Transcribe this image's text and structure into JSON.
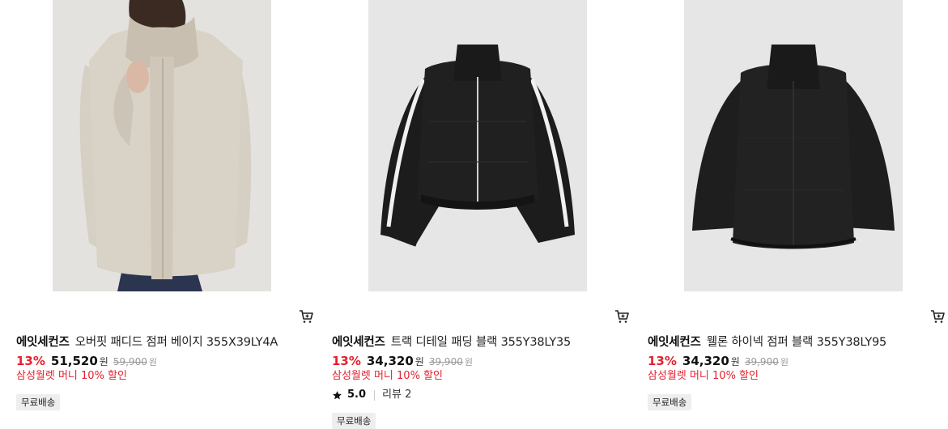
{
  "products": [
    {
      "brand": "에잇세컨즈",
      "name": "오버핏 패디드 점퍼 베이지 355X39LY4A",
      "discount": "13%",
      "price": "51,520",
      "currency": "원",
      "original_price": "59,900",
      "original_currency": "원",
      "promo": "삼성월렛 머니 10% 할인",
      "tag": "무료배송",
      "image_icon": "beige-padded-jacket-photo"
    },
    {
      "brand": "에잇세컨즈",
      "name": "트랙 디테일 패딩 블랙 355Y38LY35",
      "discount": "13%",
      "price": "34,320",
      "currency": "원",
      "original_price": "39,900",
      "original_currency": "원",
      "promo": "삼성월렛 머니 10% 할인",
      "rating": "5.0",
      "reviews": "리뷰 2",
      "tag": "무료배송",
      "image_icon": "black-track-puffer-photo"
    },
    {
      "brand": "에잇세컨즈",
      "name": "웰론 하이넥 점퍼 블랙 355Y38LY95",
      "discount": "13%",
      "price": "34,320",
      "currency": "원",
      "original_price": "39,900",
      "original_currency": "원",
      "promo": "삼성월렛 머니 10% 할인",
      "tag": "무료배송",
      "image_icon": "black-highneck-jumper-photo"
    }
  ],
  "colors": {
    "discount": "#e5202e",
    "promo": "#e5202e",
    "tag_bg": "#eeeeee",
    "strike": "#999999"
  }
}
